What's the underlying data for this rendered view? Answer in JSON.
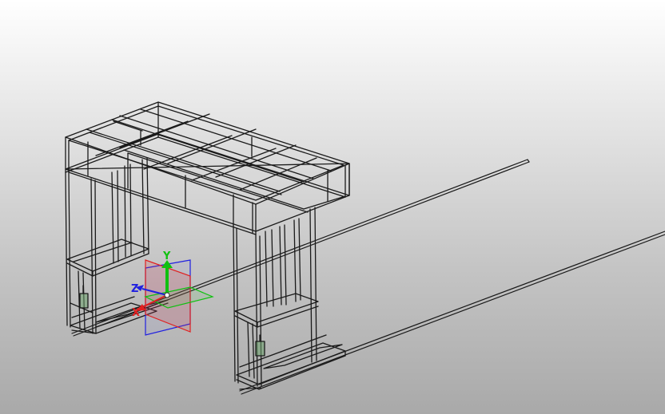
{
  "viewport": {
    "background_top": "#ffffff",
    "background_bottom": "#a9a9a9",
    "model_line_color": "#1a1a1a"
  },
  "triad": {
    "x_label": "X",
    "y_label": "Y",
    "z_label": "Z",
    "x_color": "#e02020",
    "y_color": "#10c010",
    "z_color": "#2020e0"
  }
}
